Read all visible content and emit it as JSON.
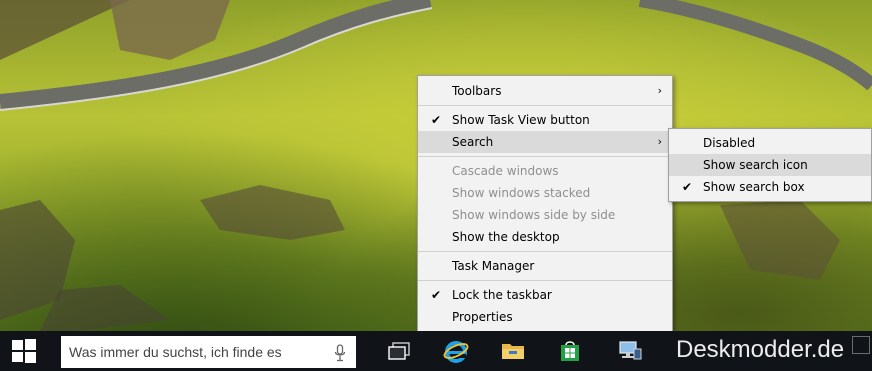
{
  "context_menu": {
    "items": [
      {
        "label": "Toolbars",
        "submenu": true,
        "checked": false,
        "disabled": false
      },
      {
        "separator": true
      },
      {
        "label": "Show Task View button",
        "submenu": false,
        "checked": true,
        "disabled": false
      },
      {
        "label": "Search",
        "submenu": true,
        "checked": false,
        "disabled": false,
        "highlighted": true
      },
      {
        "separator": true
      },
      {
        "label": "Cascade windows",
        "submenu": false,
        "checked": false,
        "disabled": true
      },
      {
        "label": "Show windows stacked",
        "submenu": false,
        "checked": false,
        "disabled": true
      },
      {
        "label": "Show windows side by side",
        "submenu": false,
        "checked": false,
        "disabled": true
      },
      {
        "label": "Show the desktop",
        "submenu": false,
        "checked": false,
        "disabled": false
      },
      {
        "separator": true
      },
      {
        "label": "Task Manager",
        "submenu": false,
        "checked": false,
        "disabled": false
      },
      {
        "separator": true
      },
      {
        "label": "Lock the taskbar",
        "submenu": false,
        "checked": true,
        "disabled": false
      },
      {
        "label": "Properties",
        "submenu": false,
        "checked": false,
        "disabled": false
      }
    ]
  },
  "search_submenu": {
    "items": [
      {
        "label": "Disabled",
        "checked": false
      },
      {
        "label": "Show search icon",
        "checked": false,
        "highlighted": true
      },
      {
        "label": "Show search box",
        "checked": true
      }
    ]
  },
  "glyphs": {
    "check": "✔",
    "arrow": "›"
  },
  "taskbar": {
    "search_placeholder": "Was immer du suchst, ich finde es",
    "icons": [
      "start-windows-icon",
      "task-view-icon",
      "internet-explorer-icon",
      "file-explorer-icon",
      "store-icon",
      "network-computer-icon"
    ]
  },
  "watermark": "Deskmodder.de",
  "colors": {
    "taskbar": "#101418",
    "menu_bg": "#f2f2f2",
    "highlight": "#dadada",
    "disabled_text": "#8f8f8f",
    "ie_blue": "#1ea1e8",
    "store_green": "#22a045"
  }
}
